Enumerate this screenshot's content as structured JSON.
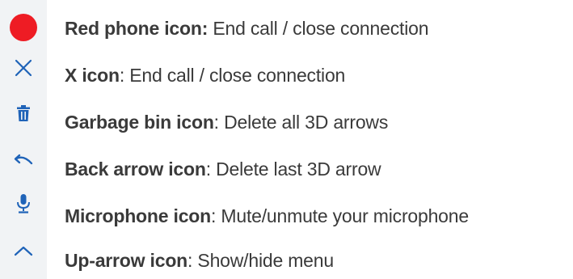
{
  "colors": {
    "icon_blue": "#1f63b8",
    "end_call_red": "#ee1c24",
    "toolbar_bg": "#f1f3f5",
    "text": "#3a3a3a"
  },
  "toolbar": {
    "items": [
      {
        "icon": "red-phone-icon"
      },
      {
        "icon": "close-x-icon"
      },
      {
        "icon": "trash-icon"
      },
      {
        "icon": "undo-arrow-icon"
      },
      {
        "icon": "microphone-icon"
      },
      {
        "icon": "chevron-up-icon"
      }
    ]
  },
  "legend": [
    {
      "name": "Red phone icon:",
      "sep": "",
      "desc": " End call / close connection"
    },
    {
      "name": "X icon",
      "sep": ":",
      "desc": " End call / close connection"
    },
    {
      "name": "Garbage bin icon",
      "sep": ":",
      "desc": " Delete all 3D arrows"
    },
    {
      "name": "Back arrow icon",
      "sep": ":",
      "desc": " Delete last 3D arrow"
    },
    {
      "name": "Microphone icon",
      "sep": ":",
      "desc": " Mute/unmute your microphone"
    },
    {
      "name": "Up-arrow icon",
      "sep": ":",
      "desc": " Show/hide menu"
    }
  ]
}
